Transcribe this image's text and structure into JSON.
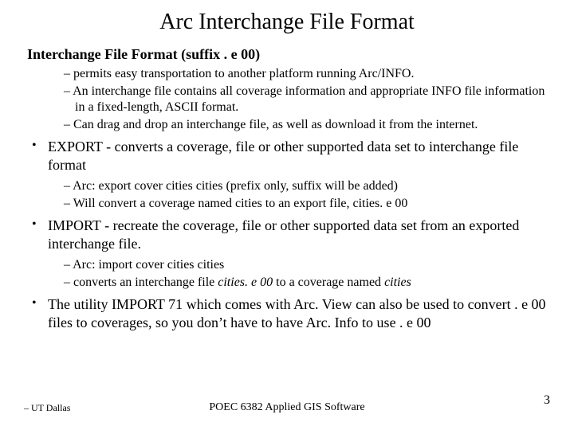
{
  "title": "Arc Interchange File Format",
  "subtitle": "Interchange File Format  (suffix . e 00)",
  "sub_bullets": [
    "permits easy transportation to another platform running Arc/INFO.",
    "An interchange file contains all coverage information and appropriate INFO file information in a fixed-length, ASCII format.",
    "Can drag and drop an interchange file, as well as download it from the internet."
  ],
  "b1": "EXPORT - converts a coverage, file or other supported data set to interchange file format",
  "b1_subs": [
    "Arc:  export  cover  cities  cities  (prefix only, suffix will be added)",
    "Will convert a coverage named cities to an export file, cities. e 00"
  ],
  "b2": "IMPORT - recreate the coverage, file or other supported data set from an exported interchange file.",
  "b2_subs_a": "Arc:  import  cover  cities  cities",
  "b2_subs_b_pre": "converts an interchange file ",
  "b2_subs_b_it1": "cities. e 00",
  "b2_subs_b_mid": " to a coverage named ",
  "b2_subs_b_it2": "cities",
  "b3": "The utility IMPORT 71 which comes with Arc. View can also be  used to convert . e 00 files to coverages, so you don’t have to have Arc. Info to use . e 00",
  "page": "3",
  "footer_left": "– UT Dallas",
  "footer_center": "POEC 6382 Applied GIS Software"
}
